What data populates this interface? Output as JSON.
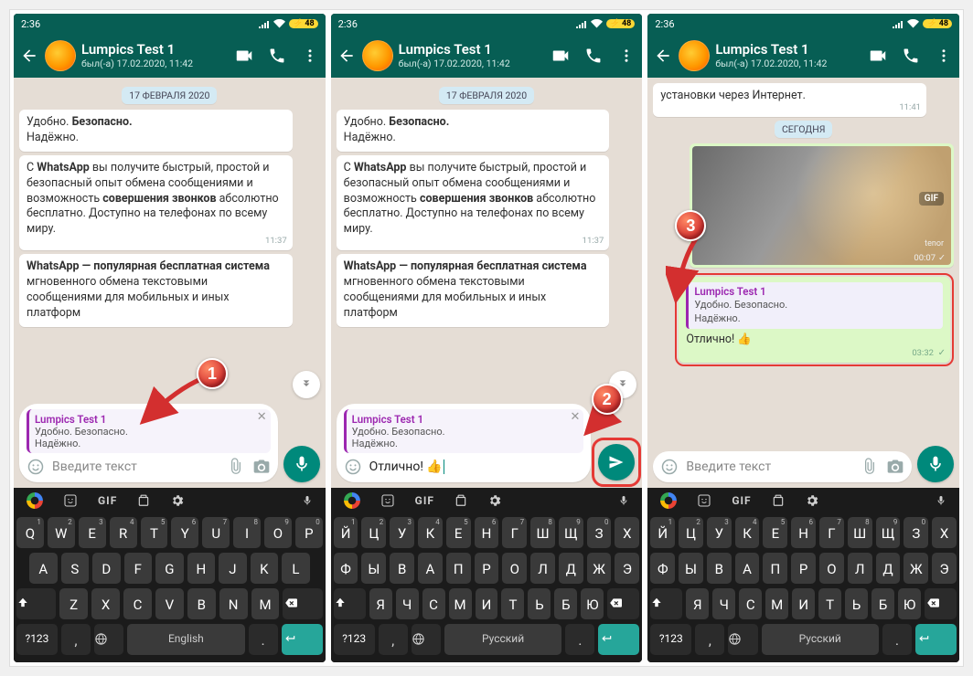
{
  "status": {
    "time": "2:36",
    "battery": "48"
  },
  "header": {
    "title": "Lumpics Test 1",
    "subtitle": "был(-а) 17.02.2020, 11:42"
  },
  "date_chip_feb": "17 ФЕВРАЛЯ 2020",
  "date_chip_today": "СЕГОДНЯ",
  "bubble1": {
    "l1": "Удобно. ",
    "b1": "Безопасно.",
    "l2": "Надёжно."
  },
  "bubble2": {
    "p1a": "С ",
    "p1b": "WhatsApp",
    "p1c": " вы получите быстрый, простой и безопасный опыт обмена сообщениями и возможность ",
    "p1d": "совершения звонков",
    "p1e": " абсолютно бесплатно. Доступно на телефонах по всему миру.",
    "time": "11:37"
  },
  "bubble3": {
    "b1": "WhatsApp — популярная бесплатная система",
    "rest": " мгновенного обмена текстовыми сообщениями для мобильных и иных платформ"
  },
  "p3": {
    "prev_msg_tail": "установки через Интернет.",
    "prev_time": "11:41",
    "gif_label": "GIF",
    "gif_credit": "tenor",
    "gif_time": "00:07",
    "reply_sender": "Lumpics Test 1",
    "reply_l1": "Удобно. Безопасно.",
    "reply_l2": "Надёжно.",
    "out_text": "Отлично! 👍",
    "out_time": "03:32"
  },
  "reply_preview": {
    "sender": "Lumpics Test 1",
    "l1": "Удобно. Безопасно.",
    "l2": "Надёжно."
  },
  "input": {
    "placeholder": "Введите текст",
    "typed": "Отлично! 👍"
  },
  "kbd_en": {
    "r1": [
      "Q",
      "W",
      "E",
      "R",
      "T",
      "Y",
      "U",
      "I",
      "O",
      "P"
    ],
    "r1h": [
      "1",
      "2",
      "3",
      "4",
      "5",
      "6",
      "7",
      "8",
      "9",
      "0"
    ],
    "r2": [
      "A",
      "S",
      "D",
      "F",
      "G",
      "H",
      "J",
      "K",
      "L"
    ],
    "r3": [
      "Z",
      "X",
      "C",
      "V",
      "B",
      "N",
      "M"
    ],
    "space": "English",
    "symkey": "?123",
    "period": "."
  },
  "kbd_ru": {
    "r1": [
      "Й",
      "Ц",
      "У",
      "К",
      "Е",
      "Н",
      "Г",
      "Ш",
      "Щ",
      "З",
      "Х"
    ],
    "r1h": [
      "1",
      "2",
      "3",
      "4",
      "5",
      "6",
      "7",
      "8",
      "9",
      "0",
      ""
    ],
    "r2": [
      "Ф",
      "Ы",
      "В",
      "А",
      "П",
      "Р",
      "О",
      "Л",
      "Д",
      "Ж",
      "Э"
    ],
    "r3": [
      "Я",
      "Ч",
      "С",
      "М",
      "И",
      "Т",
      "Ь",
      "Б",
      "Ю"
    ],
    "space": "Русский",
    "symkey": "?123",
    "period": "."
  },
  "kbd_strip": {
    "gif": "GIF"
  },
  "anno": {
    "n1": "1",
    "n2": "2",
    "n3": "3"
  }
}
